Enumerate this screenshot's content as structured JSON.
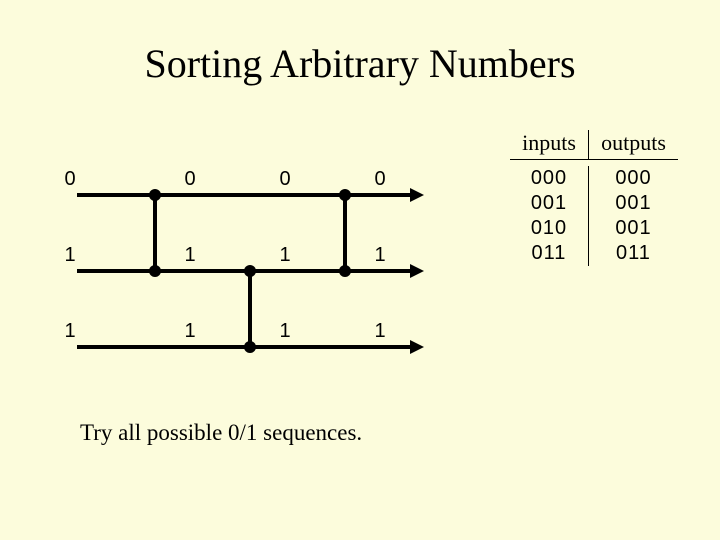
{
  "title": "Sorting Arbitrary Numbers",
  "caption": "Try all possible 0/1 sequences.",
  "table": {
    "header_in": "inputs",
    "header_out": "outputs",
    "inputs": [
      "000",
      "001",
      "010",
      "011"
    ],
    "outputs": [
      "000",
      "001",
      "001",
      "011"
    ]
  },
  "network": {
    "wire_labels": [
      [
        "0",
        "0",
        "0",
        "0"
      ],
      [
        "1",
        "1",
        "1",
        "1"
      ],
      [
        "1",
        "1",
        "1",
        "1"
      ]
    ]
  },
  "chart_data": {
    "type": "diagram",
    "description": "Sorting network with 3 wires and 3 comparators",
    "wires": 3,
    "comparators": [
      {
        "stage": 0,
        "a": 0,
        "b": 1
      },
      {
        "stage": 1,
        "a": 1,
        "b": 2
      },
      {
        "stage": 2,
        "a": 0,
        "b": 1
      }
    ],
    "wire_values_per_stage": [
      [
        "0",
        "0",
        "0",
        "0"
      ],
      [
        "1",
        "1",
        "1",
        "1"
      ],
      [
        "1",
        "1",
        "1",
        "1"
      ]
    ],
    "io_table": {
      "inputs": [
        "000",
        "001",
        "010",
        "011"
      ],
      "outputs": [
        "000",
        "001",
        "001",
        "011"
      ]
    }
  }
}
